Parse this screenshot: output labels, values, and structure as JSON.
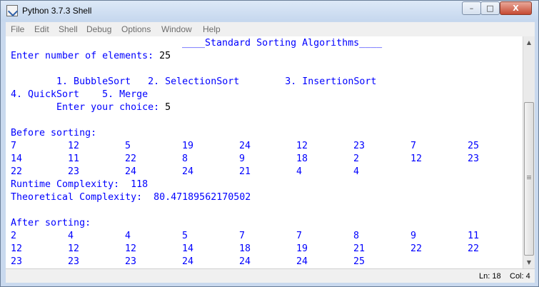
{
  "window": {
    "title": "Python 3.7.3 Shell",
    "minimize_symbol": "–",
    "maximize_symbol": "□",
    "close_symbol": "X"
  },
  "menu": {
    "items": [
      "File",
      "Edit",
      "Shell",
      "Debug",
      "Options",
      "Window",
      "Help"
    ]
  },
  "shell": {
    "header": "____Standard Sorting Algorithms____",
    "prompt_count_label": "Enter number of elements: ",
    "prompt_count_value": "25",
    "options_line1": "        1. BubbleSort   2. SelectionSort        3. InsertionSort",
    "options_line2": "4. QuickSort    5. Merge",
    "choice_label": "        Enter your choice: ",
    "choice_value": "5",
    "before_label": "Before sorting:",
    "before_rows": [
      [
        "7",
        "12",
        "5",
        "19",
        "24",
        "12",
        "23",
        "7",
        "25"
      ],
      [
        "14",
        "11",
        "22",
        "8",
        "9",
        "18",
        "2",
        "12",
        "23"
      ],
      [
        "22",
        "23",
        "24",
        "24",
        "21",
        "4",
        "4"
      ]
    ],
    "runtime_label": "Runtime Complexity:  ",
    "runtime_value": "118",
    "theoretical_label": "Theoretical Complexity:  ",
    "theoretical_value": "80.47189562170502",
    "after_label": "After sorting:",
    "after_rows": [
      [
        "2",
        "4",
        "4",
        "5",
        "7",
        "7",
        "8",
        "9",
        "11"
      ],
      [
        "12",
        "12",
        "12",
        "14",
        "18",
        "19",
        "21",
        "22",
        "22"
      ],
      [
        "23",
        "23",
        "23",
        "24",
        "24",
        "24",
        "25"
      ]
    ]
  },
  "status": {
    "line": "Ln: 18",
    "col": "Col: 4"
  }
}
